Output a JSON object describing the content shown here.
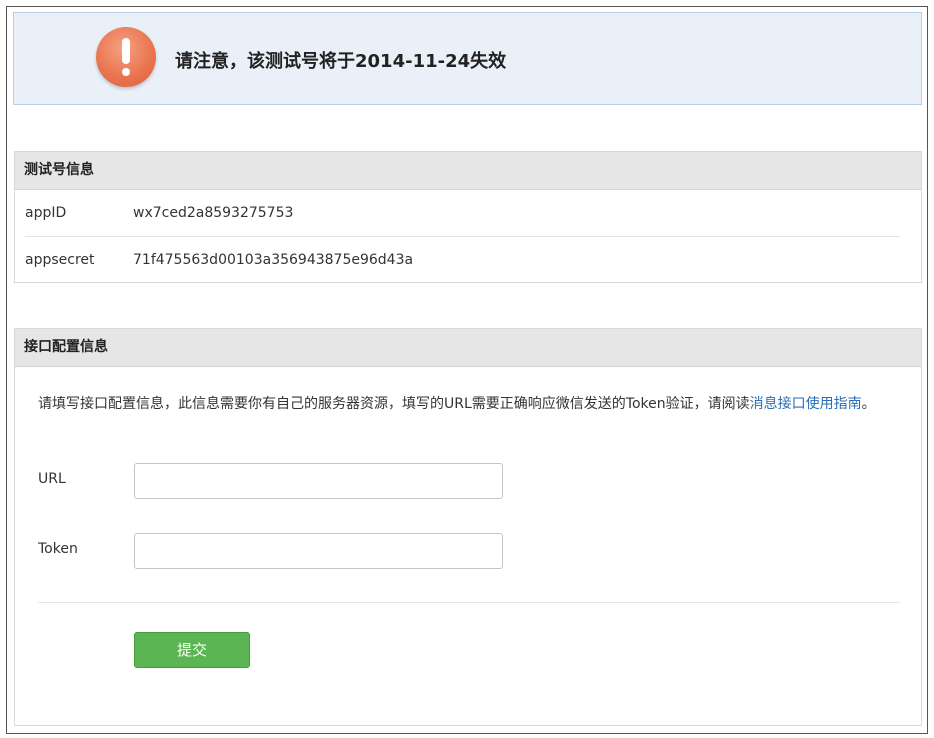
{
  "notice": {
    "icon": "exclamation-icon",
    "icon_color": "#ea7651",
    "text": "请注意，该测试号将于2014-11-24失效"
  },
  "test_account": {
    "title": "测试号信息",
    "rows": [
      {
        "label": "appID",
        "value": "wx7ced2a8593275753"
      },
      {
        "label": "appsecret",
        "value": "71f475563d00103a356943875e96d43a"
      }
    ]
  },
  "interface_config": {
    "title": "接口配置信息",
    "description": "请填写接口配置信息，此信息需要你有自己的服务器资源，填写的URL需要正确响应微信发送的Token验证，请阅读",
    "link_text": "消息接口使用指南",
    "description_end": "。",
    "url_label": "URL",
    "url_value": "",
    "token_label": "Token",
    "token_value": "",
    "submit_label": "提交",
    "link_color": "#2a6eb5",
    "button_color": "#5bb552"
  }
}
